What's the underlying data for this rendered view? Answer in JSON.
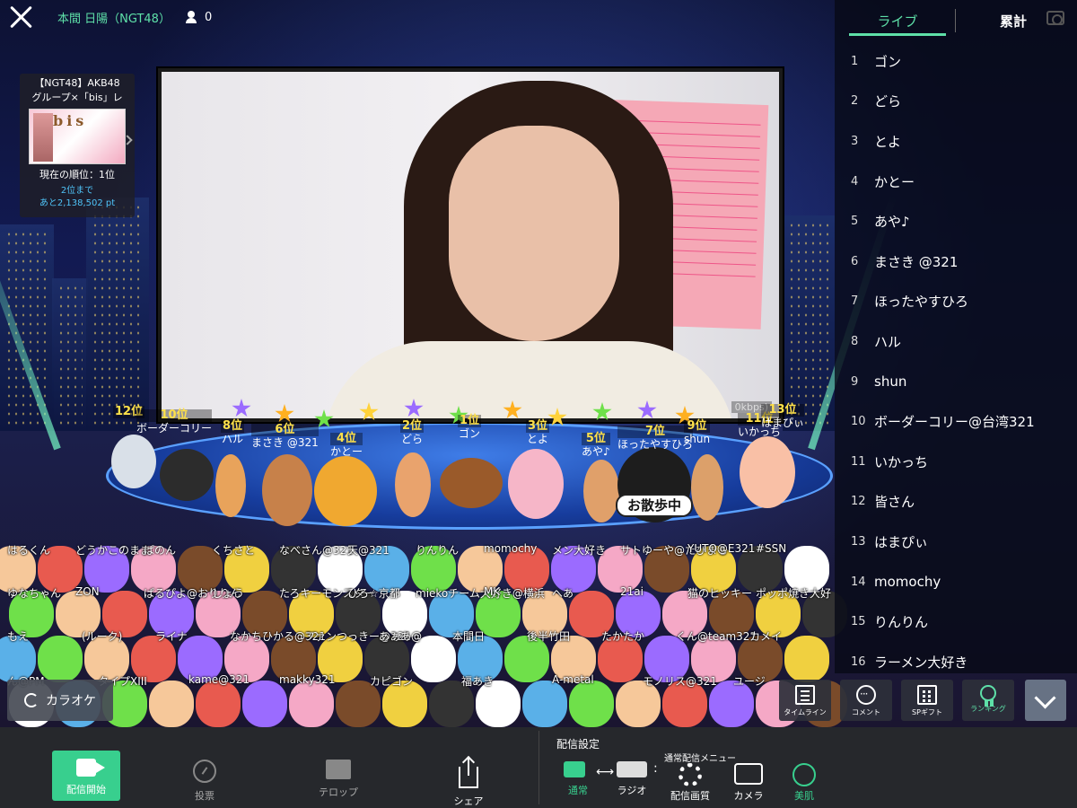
{
  "header": {
    "streamer_name": "本間 日陽（NGT48）",
    "viewer_count": "0",
    "icons": [
      "close-icon",
      "viewer-person-icon"
    ]
  },
  "event_card": {
    "title_line1": "【NGT48】AKB48",
    "title_line2": "グループ×「bis」レ",
    "thumb_logo": "bis",
    "current_rank": "現在の順位：1位",
    "gap_line1": "2位まで",
    "gap_line2": "あと2,138,502 pt"
  },
  "video": {
    "bitrate": "0kbps)"
  },
  "stage_ranks": [
    {
      "pos": "12位",
      "name": ""
    },
    {
      "pos": "10位",
      "name": "ボーダーコリー"
    },
    {
      "pos": "8位",
      "name": "ハル"
    },
    {
      "pos": "6位",
      "name": "まさき @321"
    },
    {
      "pos": "4位",
      "name": "かとー"
    },
    {
      "pos": "2位",
      "name": "どら"
    },
    {
      "pos": "1位",
      "name": "ゴン"
    },
    {
      "pos": "3位",
      "name": "とよ"
    },
    {
      "pos": "5位",
      "name": "あや♪"
    },
    {
      "pos": "7位",
      "name": "ほったやすひろ"
    },
    {
      "pos": "9位",
      "name": "shun"
    },
    {
      "pos": "11位",
      "name": "いかっち"
    },
    {
      "pos": "13位",
      "name": "はまぴぃ"
    }
  ],
  "stage_sign": "お散歩中",
  "audience_names": [
    "はるくん",
    "どうかこのまま",
    "ぱのん",
    "くちさと",
    "なべさん@321",
    "天@321",
    "りんりん",
    "momochy",
    "メン大好き",
    "サトゆーや@たびまる",
    "YUTO@E321",
    "#SSN",
    "ゆなちゃん",
    "ZON",
    "ぱるぴよ@おりりん",
    "しょう",
    "たろキーモンスター",
    "ひろ☆京都",
    "miekoチーム大好き@横浜",
    "MK",
    "へあ",
    "21ai",
    "猫のヒッキー",
    "ポッポ焼き大好",
    "もえ",
    "(ルーク)",
    "ライナ",
    "なかちひかる@321",
    "ファンつっきー@321",
    "あぁあ@",
    "本間日",
    "後半竹田",
    "たかたか",
    "くん@team321",
    "カメイ",
    "ん@PM",
    "タイプXIII",
    "kame@321",
    "makky321",
    "カピゴン",
    "福あき",
    "A-metal",
    "モノリス@321",
    "ユージ"
  ],
  "ranking": {
    "tab_live": "ライブ",
    "tab_total": "累計",
    "entries": [
      {
        "rank": "1",
        "name": "ゴン"
      },
      {
        "rank": "2",
        "name": "どら"
      },
      {
        "rank": "3",
        "name": "とよ"
      },
      {
        "rank": "4",
        "name": "かとー"
      },
      {
        "rank": "5",
        "name": "あや♪"
      },
      {
        "rank": "6",
        "name": "まさき @321"
      },
      {
        "rank": "7",
        "name": "ほったやすひろ"
      },
      {
        "rank": "8",
        "name": "ハル"
      },
      {
        "rank": "9",
        "name": "shun"
      },
      {
        "rank": "10",
        "name": "ボーダーコリー@台湾321"
      },
      {
        "rank": "11",
        "name": "いかっち"
      },
      {
        "rank": "12",
        "name": "皆さん"
      },
      {
        "rank": "13",
        "name": "はまぴぃ"
      },
      {
        "rank": "14",
        "name": "momochy"
      },
      {
        "rank": "15",
        "name": "りんりん"
      },
      {
        "rank": "16",
        "name": "ラーメン大好き"
      }
    ]
  },
  "overlay_buttons": {
    "karaoke": "カラオケ",
    "timeline": "タイムライン",
    "comment": "コメント",
    "spgift": "SPギフト",
    "ranking": "ランキング"
  },
  "bottom_bar": {
    "start_stream": "配信開始",
    "vote": "投票",
    "telop": "テロップ",
    "share": "シェア",
    "settings_label": "配信設定",
    "mode_normal": "通常",
    "mode_radio": "ラジオ",
    "menu_label": "通常配信メニュー",
    "quality": "配信画質",
    "camera": "カメラ",
    "beauty": "美肌"
  },
  "colors": {
    "accent_green": "#38cf8e",
    "rank_gold": "#ffe14a",
    "link_blue": "#4fc3f7"
  }
}
